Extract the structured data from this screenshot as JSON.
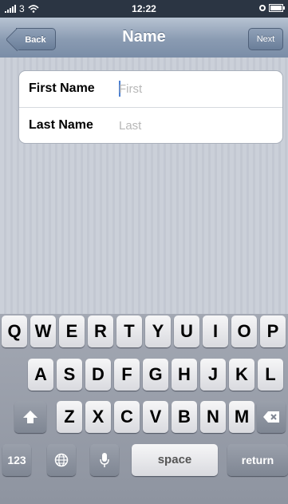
{
  "status_bar": {
    "carrier": "3",
    "time": "12:22"
  },
  "nav": {
    "title": "Name",
    "back_label": "Back",
    "next_label": "Next"
  },
  "form": {
    "first_name": {
      "label": "First Name",
      "value": "",
      "placeholder": "First"
    },
    "last_name": {
      "label": "Last Name",
      "value": "",
      "placeholder": "Last"
    }
  },
  "keyboard": {
    "row1": [
      "Q",
      "W",
      "E",
      "R",
      "T",
      "Y",
      "U",
      "I",
      "O",
      "P"
    ],
    "row2": [
      "A",
      "S",
      "D",
      "F",
      "G",
      "H",
      "J",
      "K",
      "L"
    ],
    "row3": [
      "Z",
      "X",
      "C",
      "V",
      "B",
      "N",
      "M"
    ],
    "numbers_label": "123",
    "space_label": "space",
    "return_label": "return",
    "shift_icon": "shift-icon",
    "delete_icon": "delete-icon",
    "globe_icon": "globe-icon",
    "mic_icon": "microphone-icon"
  }
}
